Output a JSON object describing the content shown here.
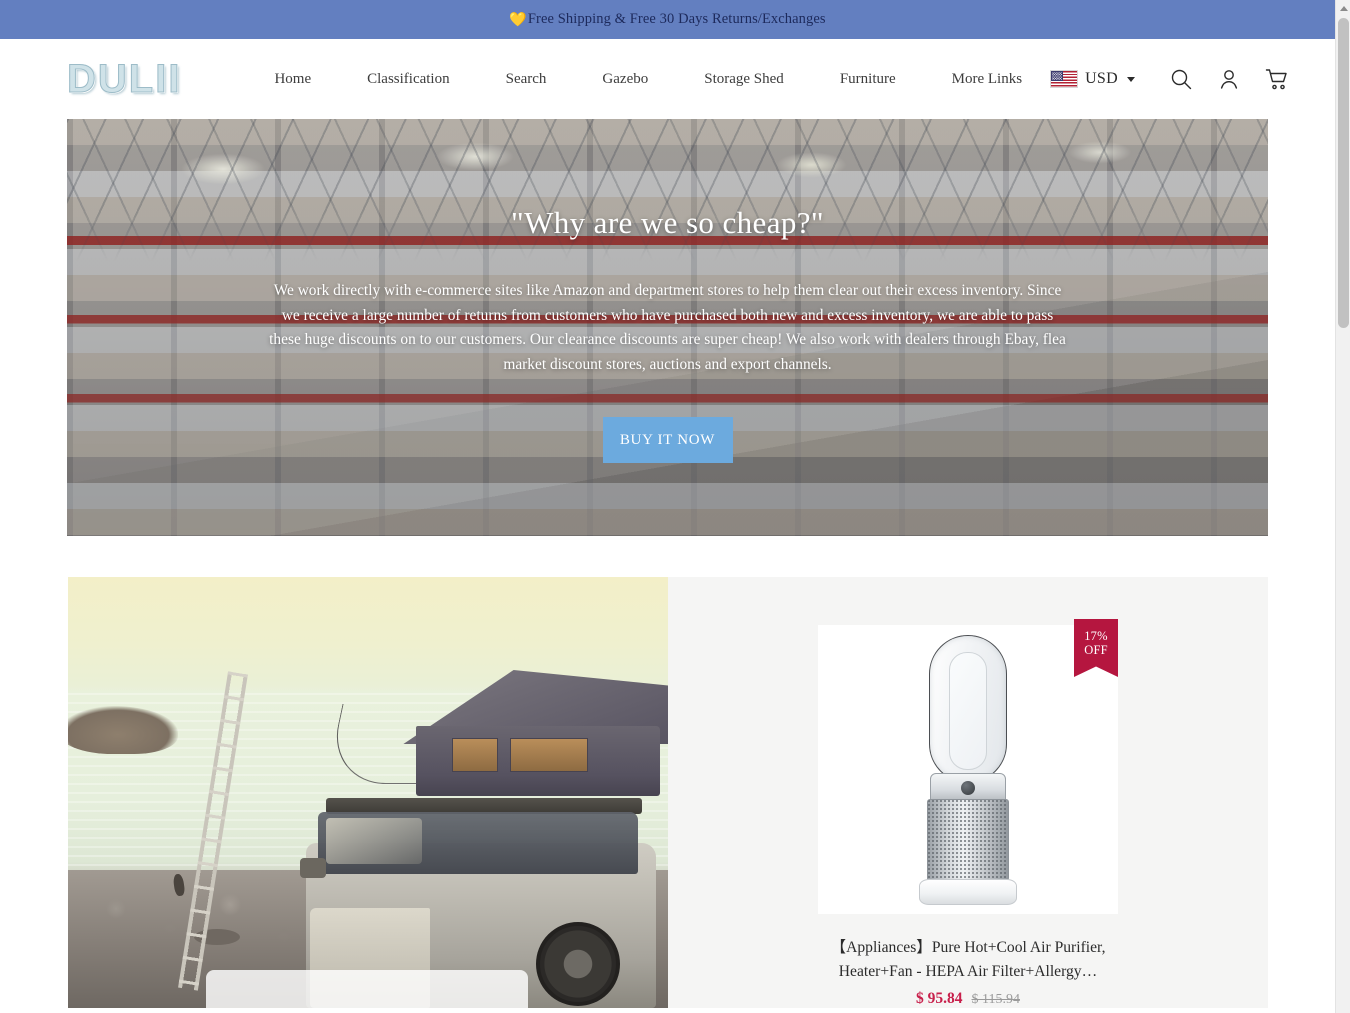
{
  "announcement": {
    "icon": "heart-icon",
    "text": "Free Shipping & Free 30 Days Returns/Exchanges"
  },
  "header": {
    "logo": "DULII",
    "nav": [
      {
        "label": "Home"
      },
      {
        "label": "Classification"
      },
      {
        "label": "Search"
      },
      {
        "label": "Gazebo"
      },
      {
        "label": "Storage Shed"
      },
      {
        "label": "Furniture"
      },
      {
        "label": "More Links"
      }
    ],
    "currency": {
      "flag": "us-flag-icon",
      "label": "USD",
      "caret": "chevron-down-icon"
    },
    "icons": {
      "search": "search-icon",
      "account": "user-account-icon",
      "cart": "shopping-cart-icon"
    }
  },
  "hero": {
    "title": "\"Why are we so cheap?\"",
    "paragraph": "We work directly with e-commerce sites like Amazon and department stores to help them clear out their excess inventory. Since we receive a large number of returns from customers who have purchased both new and excess inventory, we are able to pass these huge discounts on to our customers. Our clearance discounts are super cheap! We also work with dealers through Ebay, flea market discount stores, auctions and export channels.",
    "cta": "BUY IT NOW",
    "cta_color": "#6caade",
    "image_alt": "warehouse-racking-photo"
  },
  "feature": {
    "left_image_alt": "suv-rooftop-tent-beach-photo",
    "product": {
      "image_alt": "air-purifier-tower-fan-photo",
      "badge_line1": "17%",
      "badge_line2": "OFF",
      "badge_color": "#b5163f",
      "title": "【Appliances】Pure Hot+Cool Air Purifier, Heater+Fan - HEPA Air Filter+Allergy…",
      "price_sale": "$ 95.84",
      "price_original": "$ 115.94",
      "price_sale_color": "#c81f4b"
    }
  },
  "scrollbar": {
    "up_arrow": "scroll-up-arrow-icon"
  }
}
